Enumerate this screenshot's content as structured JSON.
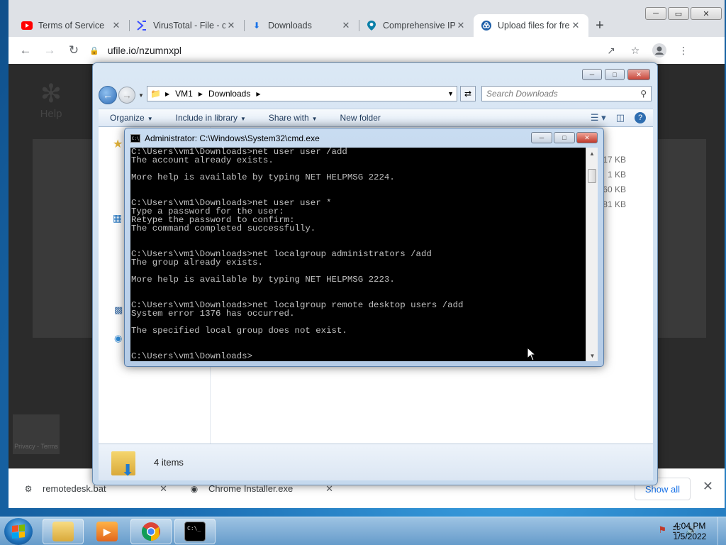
{
  "chrome": {
    "tabs": [
      {
        "title": "Terms of Service",
        "icon": "youtube-icon",
        "color": "#ff0000"
      },
      {
        "title": "VirusTotal - File - c",
        "icon": "virustotal-icon",
        "color": "#394eff"
      },
      {
        "title": "Downloads",
        "icon": "download-icon",
        "color": "#1a73e8"
      },
      {
        "title": "Comprehensive IP",
        "icon": "location-pin-icon",
        "color": "#0b7fa8"
      },
      {
        "title": "Upload files for fre",
        "icon": "ufile-icon",
        "color": "#1f5fa8"
      }
    ],
    "url": "ufile.io/nzumnxpl",
    "page": {
      "logo_text": "Help",
      "recaptcha_text": "Privacy - Terms"
    },
    "downloads_bar": {
      "items": [
        {
          "name": "remotedesk.bat",
          "icon": "batch-file-icon"
        },
        {
          "name": "Chrome Installer.exe",
          "icon": "chrome-icon"
        }
      ],
      "show_all": "Show all"
    }
  },
  "explorer": {
    "breadcrumb": [
      "VM1",
      "Downloads"
    ],
    "search_placeholder": "Search Downloads",
    "commands": [
      "Organize",
      "Include in library",
      "Share with",
      "New folder"
    ],
    "file_sizes": [
      "17 KB",
      "1 KB",
      "60 KB",
      "81 KB"
    ],
    "status_count": "4 items"
  },
  "cmd": {
    "title": "Administrator: C:\\Windows\\System32\\cmd.exe",
    "lines": [
      "C:\\Users\\vm1\\Downloads>net user user /add",
      "The account already exists.",
      "",
      "More help is available by typing NET HELPMSG 2224.",
      "",
      "",
      "C:\\Users\\vm1\\Downloads>net user user *",
      "Type a password for the user:",
      "Retype the password to confirm:",
      "The command completed successfully.",
      "",
      "",
      "C:\\Users\\vm1\\Downloads>net localgroup administrators /add",
      "The group already exists.",
      "",
      "More help is available by typing NET HELPMSG 2223.",
      "",
      "",
      "C:\\Users\\vm1\\Downloads>net localgroup remote desktop users /add",
      "System error 1376 has occurred.",
      "",
      "The specified local group does not exist.",
      "",
      "",
      "C:\\Users\\vm1\\Downloads>"
    ]
  },
  "taskbar": {
    "time": "4:04 PM",
    "date": "1/5/2022",
    "pinned": [
      "explorer-icon",
      "media-player-icon",
      "chrome-icon",
      "cmd-icon"
    ]
  }
}
